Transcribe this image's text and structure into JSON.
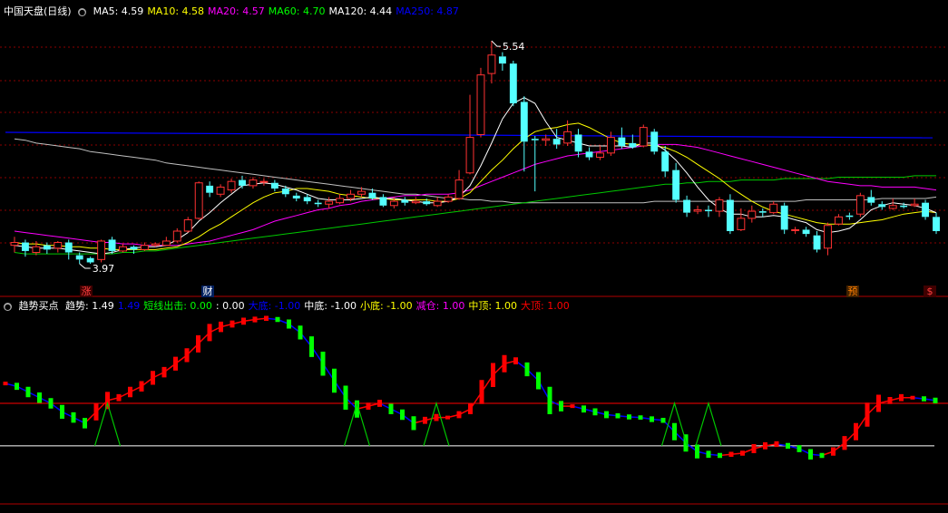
{
  "main": {
    "stock_name": "中国天盘",
    "period": "(日线)",
    "ma": [
      {
        "label": "MA5: ",
        "value": "4.59",
        "color": "#ffffff"
      },
      {
        "label": "MA10: ",
        "value": "4.58",
        "color": "#ffff00"
      },
      {
        "label": "MA20: ",
        "value": "4.57",
        "color": "#ff00ff"
      },
      {
        "label": "MA60: ",
        "value": "4.70",
        "color": "#00ff00"
      },
      {
        "label": "MA120: ",
        "value": "4.44",
        "color": "#ffffff"
      },
      {
        "label": "MA250: ",
        "value": "4.87",
        "color": "#0000ff"
      }
    ],
    "high_label": "5.54",
    "low_label": "3.97",
    "tags": [
      {
        "text": "涨",
        "color": "#ff4040",
        "bg": "#400000"
      },
      {
        "text": "财",
        "color": "#ffffff",
        "bg": "#002060"
      },
      {
        "text": "预",
        "color": "#ff8000",
        "bg": "#402000"
      },
      {
        "text": "$",
        "color": "#ff4040",
        "bg": "#400000"
      }
    ]
  },
  "indicator": {
    "name": "趋势买点",
    "fields": [
      {
        "label": "趋势: ",
        "value": "1.49",
        "color": "#ffffff"
      },
      {
        "label": "",
        "value": "1.49",
        "color": "#0000ff"
      },
      {
        "label": "短线出击: ",
        "value": "0.00",
        "color": "#00ff00"
      },
      {
        "label": ": ",
        "value": "0.00",
        "color": "#ffffff"
      },
      {
        "label": "大底: ",
        "value": "-1.00",
        "color": "#0000ff"
      },
      {
        "label": "中底: ",
        "value": "-1.00",
        "color": "#ffffff"
      },
      {
        "label": "小底: ",
        "value": "-1.00",
        "color": "#ffff00"
      },
      {
        "label": "减仓: ",
        "value": "1.00",
        "color": "#ff00ff"
      },
      {
        "label": "中顶: ",
        "value": "1.00",
        "color": "#ffff00"
      },
      {
        "label": "大顶: ",
        "value": "1.00",
        "color": "#ff0000"
      }
    ]
  },
  "colors": {
    "up": "#ff3232",
    "down": "#54ffff",
    "grid": "#8b0000",
    "ma5": "#ffffff",
    "ma10": "#ffff00",
    "ma20": "#ff00ff",
    "ma60": "#00c800",
    "ma120": "#c0c0c0",
    "ma250": "#0000ff"
  },
  "chart_data": {
    "type": "candlestick",
    "ylim": [
      3.9,
      5.7
    ],
    "candles": [
      [
        4.1,
        4.12,
        4.16,
        4.05
      ],
      [
        4.12,
        4.06,
        4.14,
        4.02
      ],
      [
        4.05,
        4.09,
        4.13,
        4.03
      ],
      [
        4.1,
        4.07,
        4.12,
        4.04
      ],
      [
        4.08,
        4.12,
        4.13,
        4.05
      ],
      [
        4.12,
        4.05,
        4.14,
        4.0
      ],
      [
        4.03,
        4.0,
        4.05,
        3.97
      ],
      [
        4.01,
        3.98,
        4.02,
        3.97
      ],
      [
        4.0,
        4.13,
        4.14,
        3.98
      ],
      [
        4.14,
        4.06,
        4.16,
        4.04
      ],
      [
        4.06,
        4.09,
        4.11,
        4.05
      ],
      [
        4.09,
        4.07,
        4.1,
        4.04
      ],
      [
        4.07,
        4.1,
        4.12,
        4.06
      ],
      [
        4.1,
        4.11,
        4.12,
        4.09
      ],
      [
        4.1,
        4.13,
        4.16,
        4.1
      ],
      [
        4.13,
        4.2,
        4.22,
        4.12
      ],
      [
        4.2,
        4.28,
        4.3,
        4.19
      ],
      [
        4.29,
        4.54,
        4.55,
        4.28
      ],
      [
        4.52,
        4.47,
        4.55,
        4.44
      ],
      [
        4.46,
        4.51,
        4.53,
        4.44
      ],
      [
        4.49,
        4.55,
        4.57,
        4.47
      ],
      [
        4.56,
        4.52,
        4.59,
        4.5
      ],
      [
        4.52,
        4.56,
        4.58,
        4.5
      ],
      [
        4.55,
        4.55,
        4.57,
        4.52
      ],
      [
        4.54,
        4.5,
        4.56,
        4.48
      ],
      [
        4.5,
        4.46,
        4.52,
        4.44
      ],
      [
        4.45,
        4.43,
        4.47,
        4.41
      ],
      [
        4.44,
        4.41,
        4.46,
        4.39
      ],
      [
        4.4,
        4.39,
        4.42,
        4.37
      ],
      [
        4.39,
        4.41,
        4.44,
        4.36
      ],
      [
        4.4,
        4.43,
        4.46,
        4.39
      ],
      [
        4.43,
        4.46,
        4.49,
        4.41
      ],
      [
        4.46,
        4.48,
        4.51,
        4.44
      ],
      [
        4.47,
        4.43,
        4.5,
        4.42
      ],
      [
        4.44,
        4.38,
        4.46,
        4.37
      ],
      [
        4.38,
        4.41,
        4.44,
        4.36
      ],
      [
        4.42,
        4.4,
        4.44,
        4.38
      ],
      [
        4.4,
        4.41,
        4.44,
        4.39
      ],
      [
        4.41,
        4.39,
        4.43,
        4.38
      ],
      [
        4.38,
        4.41,
        4.44,
        4.37
      ],
      [
        4.41,
        4.44,
        4.46,
        4.4
      ],
      [
        4.43,
        4.56,
        4.63,
        4.42
      ],
      [
        4.61,
        4.86,
        5.16,
        4.6
      ],
      [
        4.88,
        5.3,
        5.35,
        4.86
      ],
      [
        5.31,
        5.44,
        5.54,
        5.24
      ],
      [
        5.43,
        5.38,
        5.46,
        5.33
      ],
      [
        5.38,
        5.1,
        5.4,
        5.08
      ],
      [
        5.11,
        4.83,
        5.15,
        4.62
      ],
      [
        4.85,
        4.84,
        4.87,
        4.48
      ],
      [
        4.84,
        4.85,
        4.88,
        4.8
      ],
      [
        4.85,
        4.81,
        4.92,
        4.78
      ],
      [
        4.82,
        4.9,
        4.98,
        4.8
      ],
      [
        4.88,
        4.76,
        4.92,
        4.72
      ],
      [
        4.76,
        4.72,
        4.79,
        4.7
      ],
      [
        4.72,
        4.75,
        4.8,
        4.7
      ],
      [
        4.75,
        4.86,
        4.9,
        4.73
      ],
      [
        4.86,
        4.8,
        4.93,
        4.78
      ],
      [
        4.82,
        4.79,
        4.88,
        4.78
      ],
      [
        4.8,
        4.93,
        4.95,
        4.79
      ],
      [
        4.9,
        4.76,
        4.92,
        4.74
      ],
      [
        4.76,
        4.62,
        4.8,
        4.58
      ],
      [
        4.63,
        4.42,
        4.68,
        4.4
      ],
      [
        4.42,
        4.33,
        4.45,
        4.3
      ],
      [
        4.34,
        4.35,
        4.38,
        4.32
      ],
      [
        4.35,
        4.34,
        4.38,
        4.3
      ],
      [
        4.34,
        4.42,
        4.44,
        4.3
      ],
      [
        4.42,
        4.2,
        4.46,
        4.18
      ],
      [
        4.21,
        4.29,
        4.36,
        4.2
      ],
      [
        4.29,
        4.34,
        4.38,
        4.26
      ],
      [
        4.34,
        4.33,
        4.36,
        4.3
      ],
      [
        4.33,
        4.39,
        4.41,
        4.32
      ],
      [
        4.38,
        4.21,
        4.4,
        4.18
      ],
      [
        4.21,
        4.21,
        4.23,
        4.18
      ],
      [
        4.21,
        4.18,
        4.23,
        4.16
      ],
      [
        4.17,
        4.07,
        4.2,
        4.05
      ],
      [
        4.08,
        4.24,
        4.26,
        4.03
      ],
      [
        4.25,
        4.3,
        4.32,
        4.24
      ],
      [
        4.31,
        4.3,
        4.33,
        4.28
      ],
      [
        4.32,
        4.45,
        4.47,
        4.3
      ],
      [
        4.44,
        4.4,
        4.49,
        4.38
      ],
      [
        4.39,
        4.37,
        4.41,
        4.35
      ],
      [
        4.36,
        4.38,
        4.43,
        4.35
      ],
      [
        4.38,
        4.37,
        4.4,
        4.36
      ],
      [
        4.38,
        4.39,
        4.43,
        4.37
      ],
      [
        4.4,
        4.3,
        4.42,
        4.28
      ],
      [
        4.3,
        4.2,
        4.33,
        4.18
      ]
    ],
    "ma5": [
      4.1,
      4.09,
      4.08,
      4.08,
      4.08,
      4.07,
      4.06,
      4.05,
      4.04,
      4.05,
      4.07,
      4.08,
      4.09,
      4.09,
      4.1,
      4.14,
      4.19,
      4.27,
      4.33,
      4.4,
      4.46,
      4.52,
      4.53,
      4.54,
      4.53,
      4.51,
      4.49,
      4.46,
      4.43,
      4.42,
      4.42,
      4.42,
      4.43,
      4.44,
      4.43,
      4.43,
      4.42,
      4.41,
      4.4,
      4.4,
      4.41,
      4.44,
      4.52,
      4.66,
      4.82,
      4.99,
      5.1,
      5.14,
      5.1,
      4.97,
      4.86,
      4.84,
      4.82,
      4.8,
      4.8,
      4.8,
      4.8,
      4.79,
      4.82,
      4.82,
      4.77,
      4.7,
      4.61,
      4.51,
      4.42,
      4.36,
      4.32,
      4.32,
      4.3,
      4.3,
      4.31,
      4.3,
      4.28,
      4.26,
      4.21,
      4.19,
      4.2,
      4.22,
      4.28,
      4.35,
      4.38,
      4.4,
      4.39,
      4.38,
      4.36,
      4.33
    ],
    "ma10": [
      4.12,
      4.11,
      4.11,
      4.1,
      4.1,
      4.09,
      4.09,
      4.08,
      4.08,
      4.07,
      4.07,
      4.07,
      4.07,
      4.07,
      4.08,
      4.09,
      4.12,
      4.16,
      4.21,
      4.25,
      4.3,
      4.35,
      4.4,
      4.44,
      4.47,
      4.48,
      4.5,
      4.5,
      4.49,
      4.48,
      4.46,
      4.45,
      4.44,
      4.43,
      4.43,
      4.42,
      4.42,
      4.42,
      4.42,
      4.41,
      4.41,
      4.43,
      4.47,
      4.55,
      4.63,
      4.7,
      4.78,
      4.85,
      4.9,
      4.92,
      4.93,
      4.95,
      4.96,
      4.93,
      4.89,
      4.85,
      4.82,
      4.81,
      4.81,
      4.8,
      4.79,
      4.76,
      4.72,
      4.67,
      4.62,
      4.57,
      4.51,
      4.46,
      4.41,
      4.37,
      4.34,
      4.32,
      4.3,
      4.28,
      4.26,
      4.25,
      4.25,
      4.25,
      4.26,
      4.27,
      4.28,
      4.3,
      4.32,
      4.33,
      4.34,
      4.33
    ],
    "ma20": [
      4.2,
      4.19,
      4.18,
      4.17,
      4.16,
      4.15,
      4.14,
      4.13,
      4.12,
      4.12,
      4.11,
      4.11,
      4.1,
      4.1,
      4.1,
      4.1,
      4.11,
      4.12,
      4.13,
      4.15,
      4.17,
      4.19,
      4.21,
      4.24,
      4.27,
      4.29,
      4.31,
      4.33,
      4.35,
      4.36,
      4.38,
      4.39,
      4.41,
      4.42,
      4.43,
      4.44,
      4.45,
      4.45,
      4.46,
      4.46,
      4.46,
      4.47,
      4.49,
      4.52,
      4.55,
      4.58,
      4.61,
      4.64,
      4.67,
      4.69,
      4.71,
      4.73,
      4.74,
      4.75,
      4.76,
      4.77,
      4.78,
      4.79,
      4.8,
      4.81,
      4.81,
      4.81,
      4.8,
      4.79,
      4.77,
      4.75,
      4.73,
      4.71,
      4.69,
      4.67,
      4.65,
      4.63,
      4.61,
      4.59,
      4.57,
      4.55,
      4.54,
      4.53,
      4.52,
      4.52,
      4.51,
      4.51,
      4.51,
      4.51,
      4.5,
      4.49
    ],
    "ma60": [
      4.05,
      4.04,
      4.04,
      4.04,
      4.04,
      4.04,
      4.04,
      4.04,
      4.04,
      4.04,
      4.05,
      4.05,
      4.06,
      4.06,
      4.07,
      4.08,
      4.09,
      4.1,
      4.11,
      4.12,
      4.13,
      4.14,
      4.15,
      4.16,
      4.17,
      4.18,
      4.19,
      4.2,
      4.21,
      4.22,
      4.23,
      4.24,
      4.25,
      4.26,
      4.27,
      4.28,
      4.29,
      4.3,
      4.31,
      4.32,
      4.33,
      4.34,
      4.35,
      4.36,
      4.37,
      4.38,
      4.39,
      4.4,
      4.41,
      4.42,
      4.43,
      4.44,
      4.45,
      4.46,
      4.47,
      4.48,
      4.49,
      4.5,
      4.51,
      4.52,
      4.53,
      4.53,
      4.54,
      4.54,
      4.55,
      4.55,
      4.55,
      4.56,
      4.56,
      4.56,
      4.56,
      4.57,
      4.57,
      4.57,
      4.57,
      4.57,
      4.58,
      4.58,
      4.58,
      4.58,
      4.58,
      4.58,
      4.58,
      4.59,
      4.59,
      4.59
    ],
    "ma120": [
      4.85,
      4.84,
      4.82,
      4.81,
      4.8,
      4.79,
      4.78,
      4.76,
      4.75,
      4.74,
      4.73,
      4.72,
      4.71,
      4.7,
      4.68,
      4.67,
      4.66,
      4.65,
      4.64,
      4.63,
      4.62,
      4.61,
      4.6,
      4.59,
      4.58,
      4.57,
      4.56,
      4.55,
      4.54,
      4.53,
      4.52,
      4.51,
      4.5,
      4.49,
      4.48,
      4.47,
      4.46,
      4.46,
      4.45,
      4.44,
      4.43,
      4.43,
      4.42,
      4.42,
      4.41,
      4.41,
      4.4,
      4.4,
      4.4,
      4.4,
      4.4,
      4.4,
      4.4,
      4.4,
      4.4,
      4.4,
      4.4,
      4.4,
      4.4,
      4.41,
      4.41,
      4.41,
      4.41,
      4.41,
      4.41,
      4.41,
      4.41,
      4.41,
      4.41,
      4.41,
      4.41,
      4.41,
      4.41,
      4.42,
      4.42,
      4.42,
      4.42,
      4.42,
      4.42,
      4.42,
      4.43,
      4.43,
      4.43,
      4.43,
      4.43,
      4.44
    ],
    "ma250": 4.87,
    "ind_ylim": [
      -1.6,
      1.6
    ],
    "trend": [
      0.35,
      0.3,
      0.2,
      0.1,
      0,
      -0.15,
      -0.25,
      -0.35,
      -0.15,
      0.05,
      0.1,
      0.2,
      0.3,
      0.45,
      0.55,
      0.7,
      0.85,
      1.05,
      1.25,
      1.35,
      1.4,
      1.45,
      1.48,
      1.5,
      1.48,
      1.4,
      1.25,
      1.0,
      0.7,
      0.4,
      0.1,
      -0.1,
      -0.05,
      0,
      -0.1,
      -0.2,
      -0.35,
      -0.3,
      -0.25,
      -0.25,
      -0.2,
      -0.1,
      0.2,
      0.5,
      0.7,
      0.75,
      0.6,
      0.4,
      0.05,
      -0.05,
      -0.05,
      -0.1,
      -0.15,
      -0.2,
      -0.22,
      -0.24,
      -0.25,
      -0.28,
      -0.3,
      -0.5,
      -0.7,
      -0.85,
      -0.9,
      -0.92,
      -0.9,
      -0.88,
      -0.8,
      -0.75,
      -0.72,
      -0.75,
      -0.8,
      -0.9,
      -0.92,
      -0.85,
      -0.7,
      -0.5,
      -0.2,
      0.0,
      0.05,
      0.1,
      0.1,
      0.08,
      0.05
    ],
    "buy_signals": [
      9,
      31,
      38,
      59,
      62
    ]
  }
}
